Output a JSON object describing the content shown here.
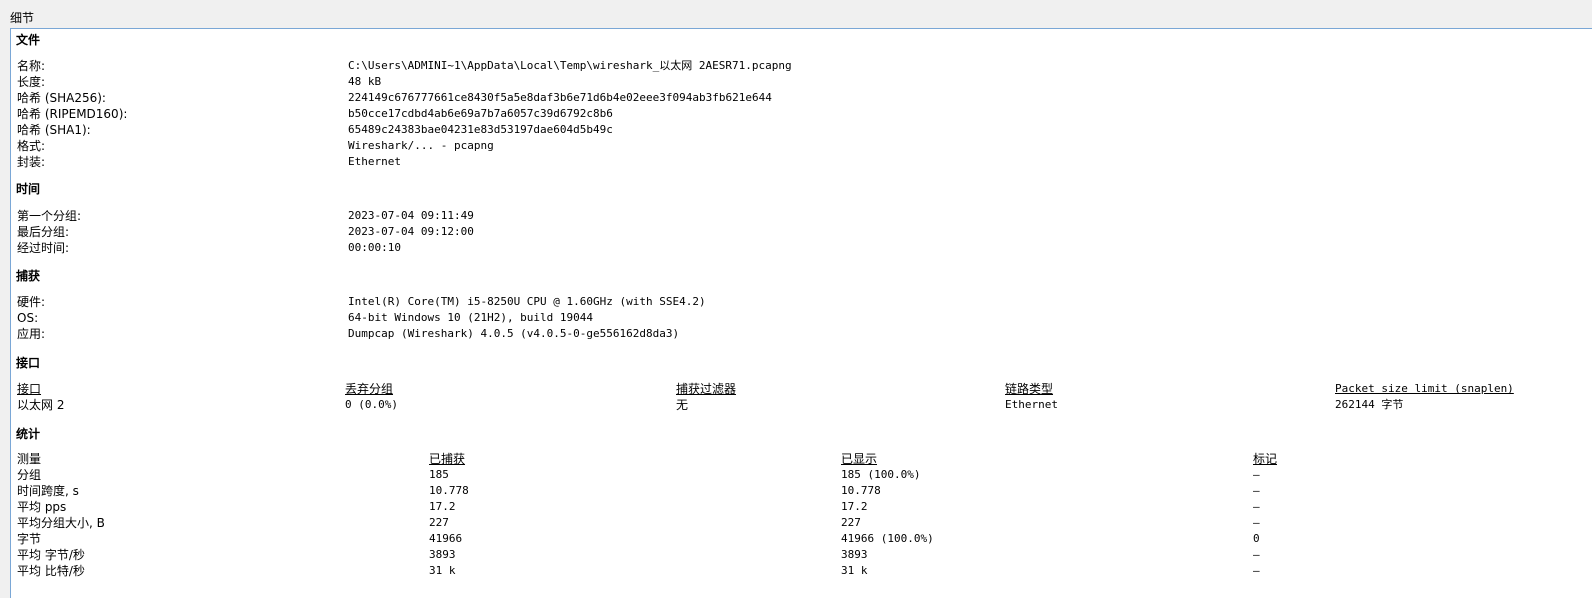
{
  "window": {
    "group_title": "细节"
  },
  "file": {
    "title": "文件",
    "rows": [
      {
        "label": "名称:",
        "value": "C:\\Users\\ADMINI~1\\AppData\\Local\\Temp\\wireshark_以太网 2AESR71.pcapng"
      },
      {
        "label": "长度:",
        "value": "48 kB"
      },
      {
        "label": "哈希 (SHA256):",
        "value": "224149c676777661ce8430f5a5e8daf3b6e71d6b4e02eee3f094ab3fb621e644"
      },
      {
        "label": "哈希 (RIPEMD160):",
        "value": "b50cce17cdbd4ab6e69a7b7a6057c39d6792c8b6"
      },
      {
        "label": "哈希 (SHA1):",
        "value": "65489c24383bae04231e83d53197dae604d5b49c"
      },
      {
        "label": "格式:",
        "value": "Wireshark/... - pcapng"
      },
      {
        "label": "封装:",
        "value": "Ethernet"
      }
    ]
  },
  "time": {
    "title": "时间",
    "rows": [
      {
        "label": "第一个分组:",
        "value": "2023-07-04 09:11:49"
      },
      {
        "label": "最后分组:",
        "value": "2023-07-04 09:12:00"
      },
      {
        "label": "经过时间:",
        "value": "00:00:10"
      }
    ]
  },
  "capture": {
    "title": "捕获",
    "rows": [
      {
        "label": "硬件:",
        "value": "Intel(R) Core(TM) i5-8250U CPU @ 1.60GHz (with SSE4.2)"
      },
      {
        "label": "OS:",
        "value": "64-bit Windows 10 (21H2), build 19044"
      },
      {
        "label": "应用:",
        "value": "Dumpcap (Wireshark) 4.0.5 (v4.0.5-0-ge556162d8da3)"
      }
    ]
  },
  "interfaces": {
    "title": "接口",
    "headers": [
      "接口",
      "丢弃分组",
      "捕获过滤器",
      "链路类型",
      "Packet size limit (snaplen)"
    ],
    "rows": [
      [
        "以太网 2",
        "0 (0.0%)",
        "无",
        "Ethernet",
        "262144 字节"
      ]
    ]
  },
  "stats": {
    "title": "统计",
    "headers": [
      "测量",
      "已捕获",
      "已显示",
      "标记"
    ],
    "rows": [
      [
        "分组",
        "185",
        "185 (100.0%)",
        "—"
      ],
      [
        "时间跨度, s",
        "10.778",
        "10.778",
        "—"
      ],
      [
        "平均 pps",
        "17.2",
        "17.2",
        "—"
      ],
      [
        "平均分组大小, B",
        "227",
        "227",
        "—"
      ],
      [
        "字节",
        "41966",
        "41966 (100.0%)",
        "0"
      ],
      [
        "平均 字节/秒",
        "3893",
        "3893",
        "—"
      ],
      [
        "平均 比特/秒",
        "31 k",
        "31 k",
        "—"
      ]
    ]
  }
}
